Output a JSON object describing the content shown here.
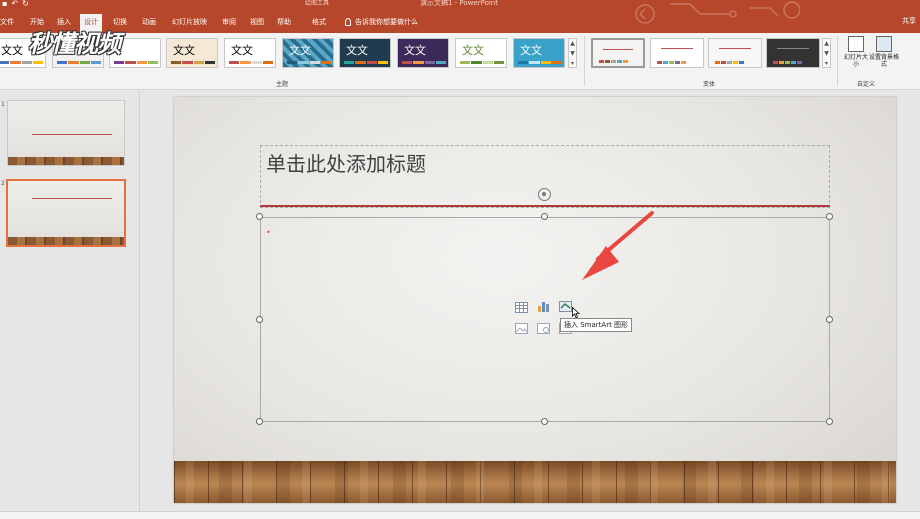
{
  "app": {
    "doc_title": "演示文稿1 - PowerPoint",
    "context_tool": "绘图工具"
  },
  "tabs": [
    {
      "label": "文件"
    },
    {
      "label": "开始"
    },
    {
      "label": "插入"
    },
    {
      "label": "设计"
    },
    {
      "label": "切换"
    },
    {
      "label": "动画"
    },
    {
      "label": "幻灯片放映"
    },
    {
      "label": "审阅"
    },
    {
      "label": "视图"
    },
    {
      "label": "帮助"
    },
    {
      "label": "格式"
    }
  ],
  "active_tab": "设计",
  "tell_me": "告诉我你想要做什么",
  "account": "共享",
  "watermark": "秒懂视频",
  "ribbon": {
    "themes_group_label": "主题",
    "variants_group_label": "变体",
    "customize_group_label": "自定义",
    "theme_sample_text": "文文",
    "slide_size_label": "幻灯片大小",
    "format_bg_label": "设置背景格式",
    "themes": [
      {
        "text": "文文",
        "bg": "#ffffff",
        "fg": "#333333"
      },
      {
        "text": "",
        "bg": "#f2f2f2",
        "fg": "#333333"
      },
      {
        "text": "文文",
        "bg": "#ffffff",
        "fg": "#333333"
      },
      {
        "text": "文文",
        "bg": "#f5e8d4",
        "fg": "#333333"
      },
      {
        "text": "文文",
        "bg": "#ffffff",
        "fg": "#333333"
      },
      {
        "text": "文文",
        "bg": "#2a6d8c",
        "fg": "#ffffff"
      },
      {
        "text": "文文",
        "bg": "#1f3b4d",
        "fg": "#ffffff"
      },
      {
        "text": "文文",
        "bg": "#3b2a5a",
        "fg": "#ffffff"
      },
      {
        "text": "文文",
        "bg": "#ffffff",
        "fg": "#5a8a2a"
      },
      {
        "text": "文文",
        "bg": "#3aa2c8",
        "fg": "#ffffff"
      }
    ]
  },
  "slides": [
    {
      "number": "1"
    },
    {
      "number": "2"
    }
  ],
  "slide": {
    "title_placeholder": "单击此处添加标题",
    "tooltip": "插入 SmartArt 图形"
  },
  "colors": {
    "accent": "#b7472a",
    "rule": "#b0393a",
    "arrow": "#e8483f"
  }
}
